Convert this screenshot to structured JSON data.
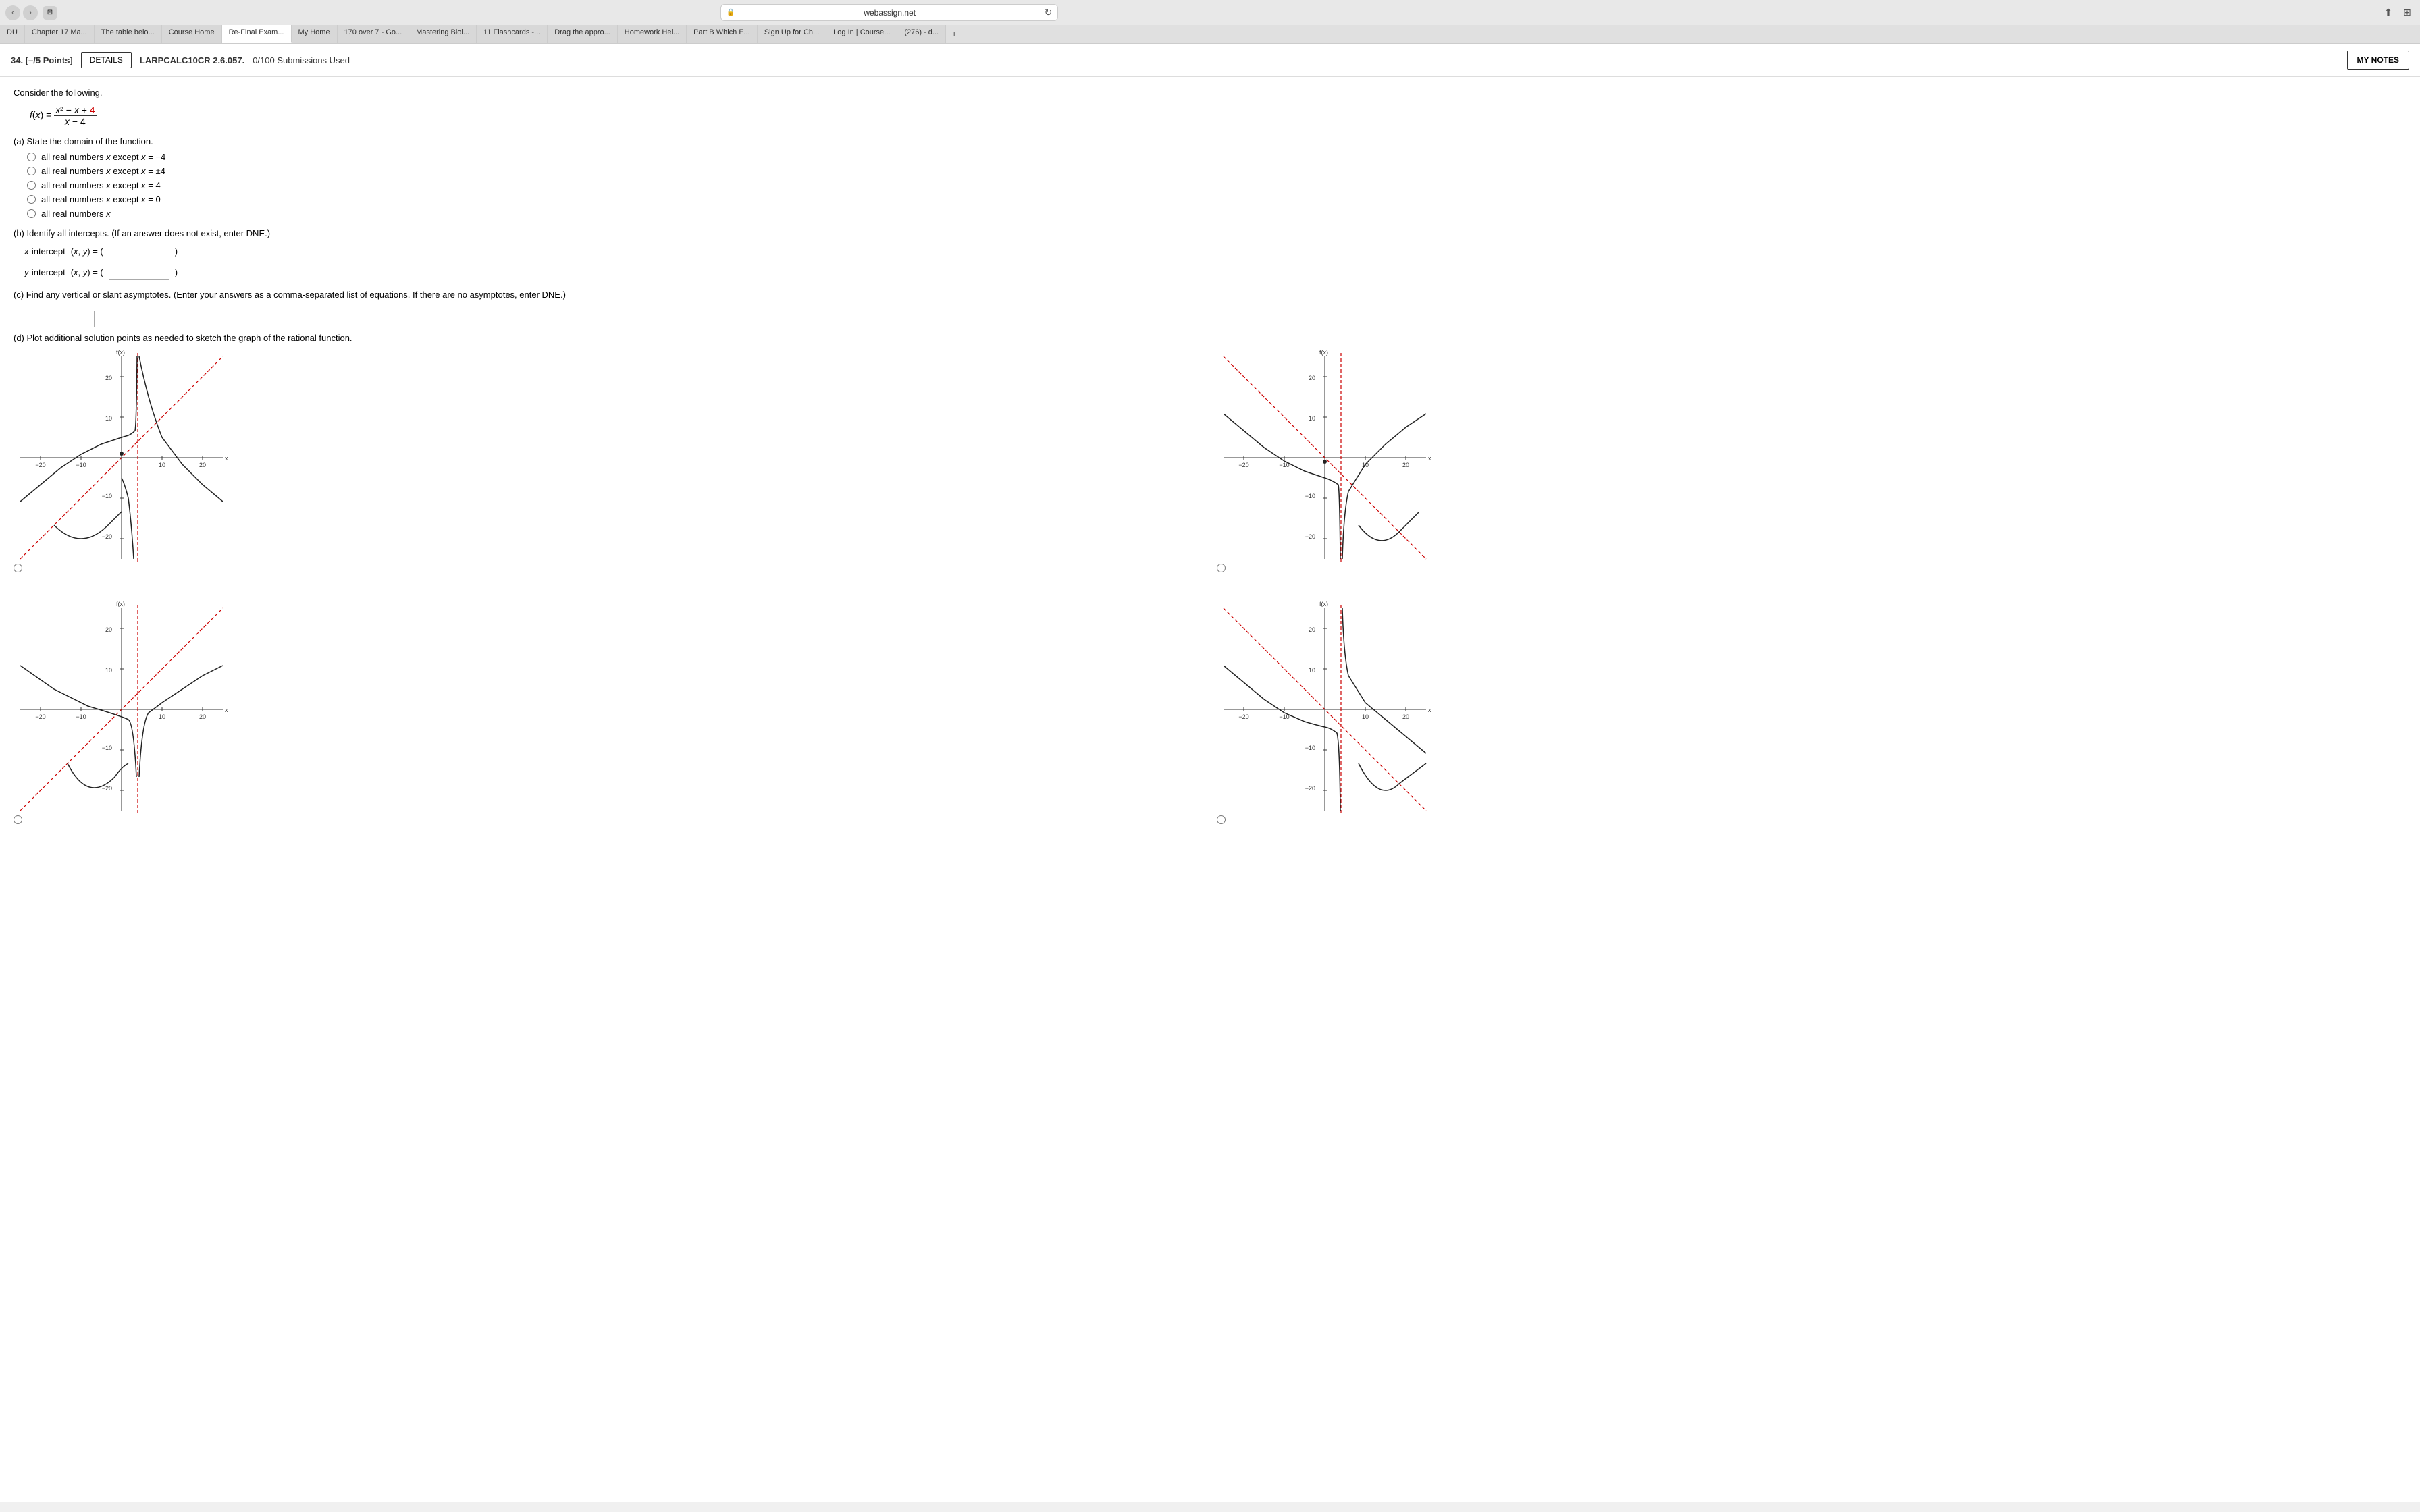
{
  "browser": {
    "url": "webassign.net",
    "lock_icon": "🔒",
    "tabs": [
      {
        "label": "DU",
        "active": false
      },
      {
        "label": "Chapter 17 Ma...",
        "active": false
      },
      {
        "label": "The table belo...",
        "active": false
      },
      {
        "label": "Course Home",
        "active": false
      },
      {
        "label": "Re-Final Exam...",
        "active": true
      },
      {
        "label": "My Home",
        "active": false
      },
      {
        "label": "170 over 7 - Go...",
        "active": false
      },
      {
        "label": "Mastering Biol...",
        "active": false
      },
      {
        "label": "11 Flashcards -...",
        "active": false
      },
      {
        "label": "Drag the appro...",
        "active": false
      },
      {
        "label": "Homework Hel...",
        "active": false
      },
      {
        "label": "Part B Which E...",
        "active": false
      },
      {
        "label": "Sign Up for Ch...",
        "active": false
      },
      {
        "label": "Log In | Course...",
        "active": false
      },
      {
        "label": "(276) - d...",
        "active": false
      }
    ]
  },
  "question": {
    "number": "34. [–/5 Points]",
    "details_label": "DETAILS",
    "problem_id": "LARPCALC10CR 2.6.057.",
    "submissions": "0/100 Submissions Used",
    "my_notes_label": "MY NOTES"
  },
  "content": {
    "consider_text": "Consider the following.",
    "function_label": "f(x) =",
    "numerator": "x² − x + 4",
    "denominator": "x − 4",
    "part_a_label": "(a) State the domain of the function.",
    "options": [
      "all real numbers x except x = −4",
      "all real numbers x except x = ±4",
      "all real numbers x except x = 4",
      "all real numbers x except x = 0",
      "all real numbers x"
    ],
    "part_b_label": "(b) Identify all intercepts. (If an answer does not exist, enter DNE.)",
    "x_intercept_label": "x-intercept",
    "x_intercept_prefix": "(x, y) = (",
    "x_intercept_suffix": ")",
    "y_intercept_label": "y-intercept",
    "y_intercept_prefix": "(x, y) = (",
    "y_intercept_suffix": ")",
    "part_c_label": "(c) Find any vertical or slant asymptotes. (Enter your answers as a comma-separated list of equations. If there are no asymptotes, enter DNE.)",
    "part_d_label": "(d) Plot additional solution points as needed to sketch the graph of the rational function."
  }
}
